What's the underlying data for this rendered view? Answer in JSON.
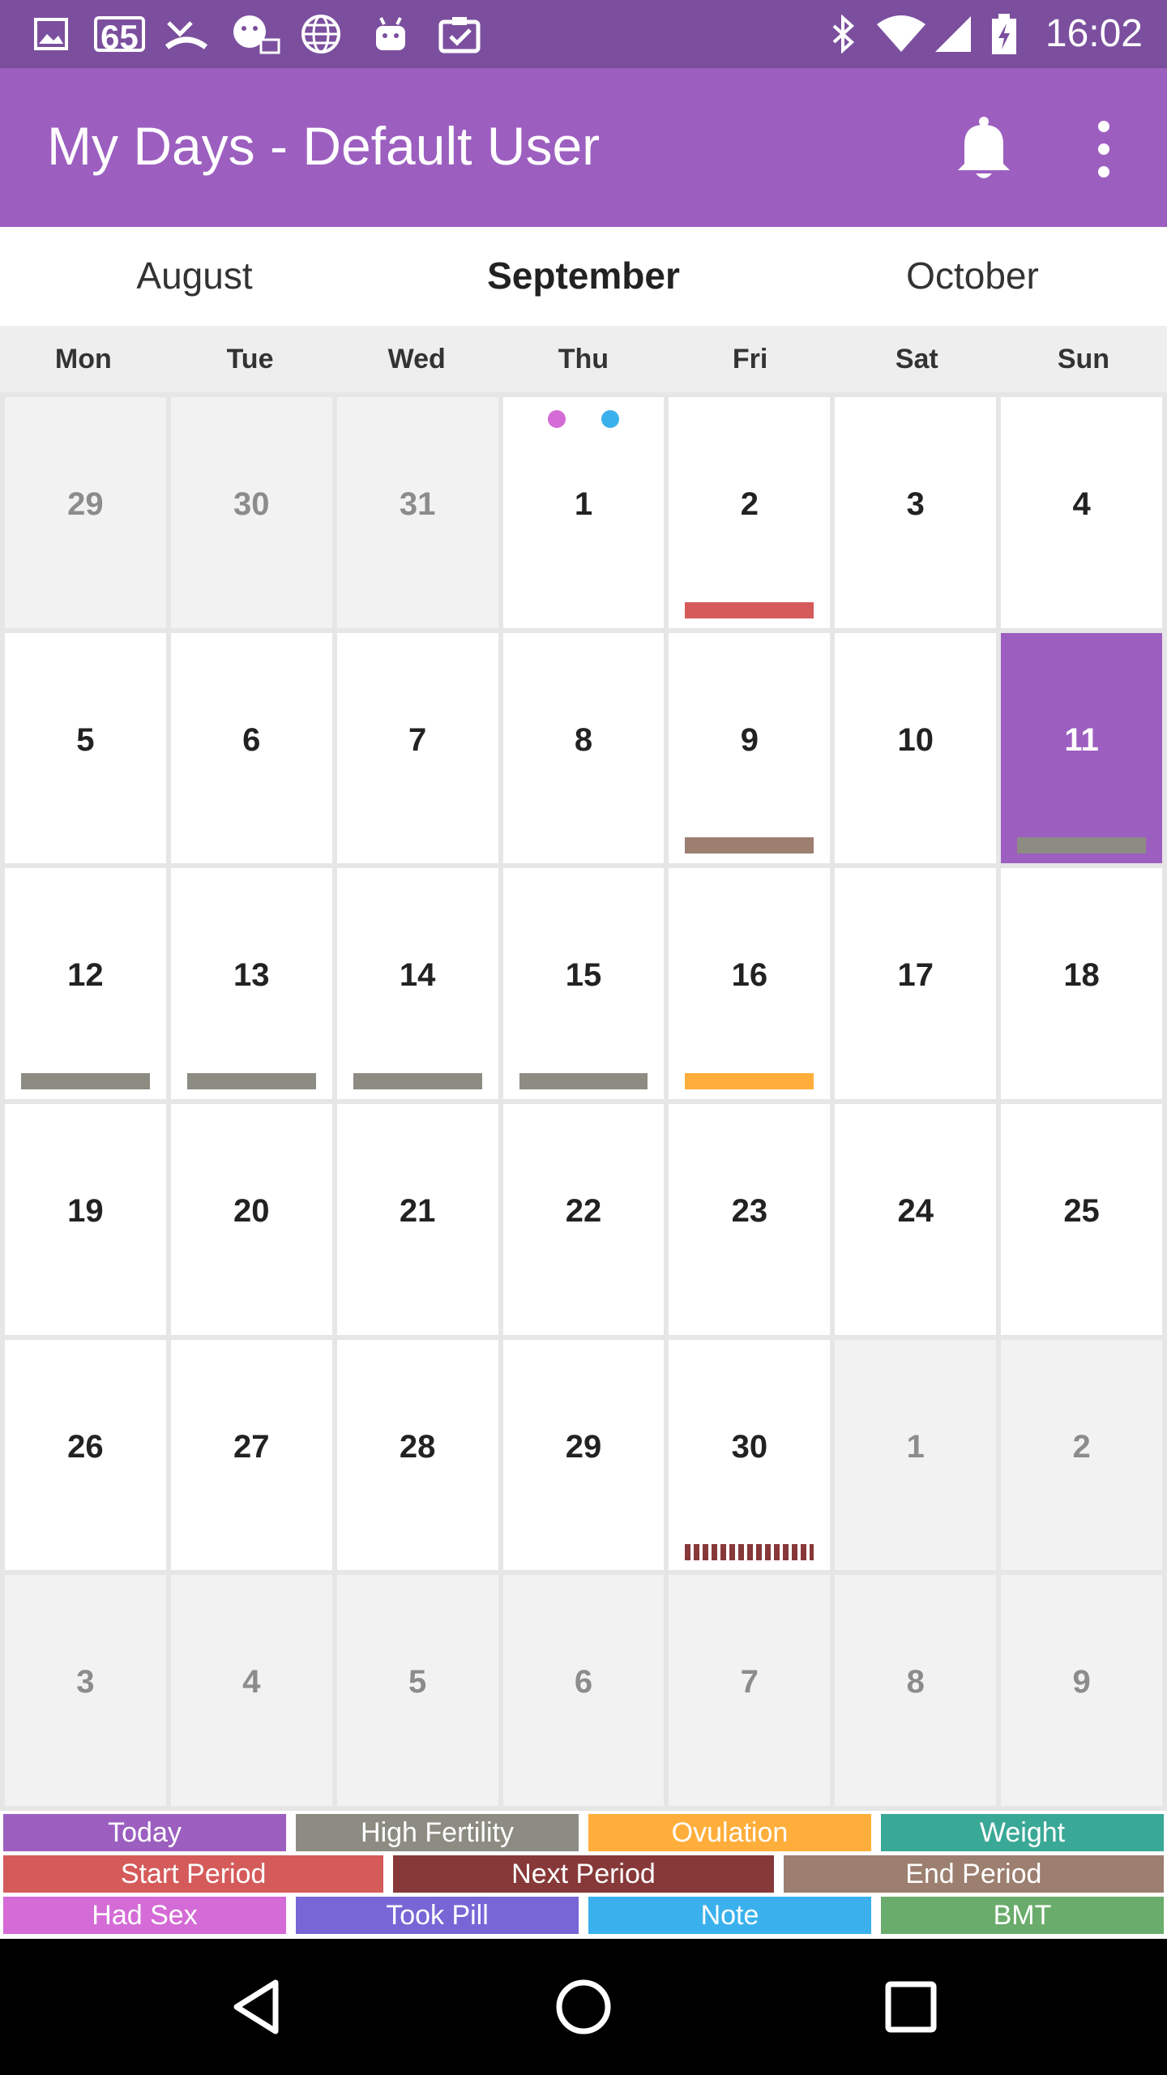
{
  "status_bar": {
    "time": "16:02",
    "notification_badge": "65",
    "icons": [
      "image-icon",
      "calendar-badge-icon",
      "missed-call-icon",
      "chat-bubble-icon",
      "globe-icon",
      "android-icon",
      "clipboard-check-icon",
      "bluetooth-icon",
      "wifi-icon",
      "signal-icon",
      "battery-charging-icon"
    ]
  },
  "app_bar": {
    "title": "My Days - Default User",
    "icons": [
      "bell-icon",
      "more-vert-icon"
    ]
  },
  "month_tabs": {
    "previous": "August",
    "current": "September",
    "next": "October"
  },
  "weekdays": [
    "Mon",
    "Tue",
    "Wed",
    "Thu",
    "Fri",
    "Sat",
    "Sun"
  ],
  "calendar": {
    "colors": {
      "today": "#9c5fc0",
      "high_fertility": "#8d8c83",
      "ovulation": "#ffae3b",
      "start_period": "#d55a5a",
      "next_period": "#873838",
      "end_period": "#9c7f70",
      "had_sex": "#d46bd6",
      "note": "#3ab1ed"
    },
    "weeks": [
      [
        {
          "day": "29",
          "other_month": true
        },
        {
          "day": "30",
          "other_month": true
        },
        {
          "day": "31",
          "other_month": true
        },
        {
          "day": "1",
          "dots": [
            "had_sex",
            "note"
          ]
        },
        {
          "day": "2",
          "bar": "start_period"
        },
        {
          "day": "3"
        },
        {
          "day": "4"
        }
      ],
      [
        {
          "day": "5"
        },
        {
          "day": "6"
        },
        {
          "day": "7"
        },
        {
          "day": "8"
        },
        {
          "day": "9",
          "bar": "end_period"
        },
        {
          "day": "10"
        },
        {
          "day": "11",
          "today": true,
          "bar": "high_fertility"
        }
      ],
      [
        {
          "day": "12",
          "bar": "high_fertility"
        },
        {
          "day": "13",
          "bar": "high_fertility"
        },
        {
          "day": "14",
          "bar": "high_fertility"
        },
        {
          "day": "15",
          "bar": "high_fertility"
        },
        {
          "day": "16",
          "bar": "ovulation"
        },
        {
          "day": "17"
        },
        {
          "day": "18"
        }
      ],
      [
        {
          "day": "19"
        },
        {
          "day": "20"
        },
        {
          "day": "21"
        },
        {
          "day": "22"
        },
        {
          "day": "23"
        },
        {
          "day": "24"
        },
        {
          "day": "25"
        }
      ],
      [
        {
          "day": "26"
        },
        {
          "day": "27"
        },
        {
          "day": "28"
        },
        {
          "day": "29"
        },
        {
          "day": "30",
          "bar": "next_period",
          "bar_style": "dashed"
        },
        {
          "day": "1",
          "other_month": true
        },
        {
          "day": "2",
          "other_month": true
        }
      ],
      [
        {
          "day": "3",
          "other_month": true
        },
        {
          "day": "4",
          "other_month": true
        },
        {
          "day": "5",
          "other_month": true
        },
        {
          "day": "6",
          "other_month": true
        },
        {
          "day": "7",
          "other_month": true
        },
        {
          "day": "8",
          "other_month": true
        },
        {
          "day": "9",
          "other_month": true
        }
      ]
    ]
  },
  "legend": {
    "rows": [
      [
        {
          "label": "Today",
          "color": "#9c5fc0"
        },
        {
          "label": "High Fertility",
          "color": "#8d8c83"
        },
        {
          "label": "Ovulation",
          "color": "#ffae3b"
        },
        {
          "label": "Weight",
          "color": "#3aa896"
        }
      ],
      [
        {
          "label": "Start Period",
          "color": "#d55a5a"
        },
        {
          "label": "Next Period",
          "color": "#873838"
        },
        {
          "label": "End Period",
          "color": "#9c7f70"
        }
      ],
      [
        {
          "label": "Had Sex",
          "color": "#d46bd6"
        },
        {
          "label": "Took Pill",
          "color": "#7866d6"
        },
        {
          "label": "Note",
          "color": "#3ab1ed"
        },
        {
          "label": "BMT",
          "color": "#6aac6b"
        }
      ]
    ]
  },
  "nav_bar": {
    "icons": [
      "back-icon",
      "home-icon",
      "recents-icon"
    ]
  }
}
